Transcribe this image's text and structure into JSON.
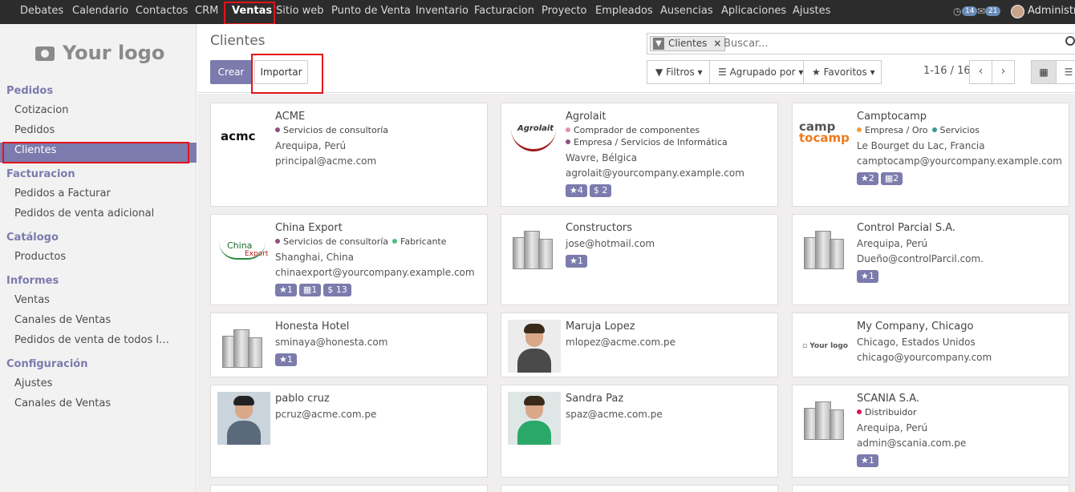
{
  "topnav": {
    "items": [
      "Debates",
      "Calendario",
      "Contactos",
      "CRM",
      "Ventas",
      "Sitio web",
      "Punto de Venta",
      "Inventario",
      "Facturacion",
      "Proyecto",
      "Empleados",
      "Ausencias",
      "Aplicaciones",
      "Ajustes"
    ],
    "active": "Ventas",
    "badge_activities": "14",
    "badge_messages": "21",
    "user": "Administrator"
  },
  "sidebar": {
    "logo": "Your logo",
    "sections": [
      {
        "title": "Pedidos",
        "items": [
          "Cotizacion",
          "Pedidos",
          "Clientes"
        ]
      },
      {
        "title": "Facturacion",
        "items": [
          "Pedidos a Facturar",
          "Pedidos de venta adicional"
        ]
      },
      {
        "title": "Catálogo",
        "items": [
          "Productos"
        ]
      },
      {
        "title": "Informes",
        "items": [
          "Ventas",
          "Canales de Ventas",
          "Pedidos de venta de todos los…"
        ]
      },
      {
        "title": "Configuración",
        "items": [
          "Ajustes",
          "Canales de Ventas"
        ]
      }
    ],
    "active_item": "Clientes"
  },
  "control": {
    "breadcrumb": "Clientes",
    "create_label": "Crear",
    "import_label": "Importar",
    "search_facet": "Clientes",
    "search_placeholder": "Buscar...",
    "filters_label": "Filtros",
    "groupby_label": "Agrupado por",
    "favorites_label": "Favoritos",
    "pager": "1-16 / 16"
  },
  "customers": [
    {
      "name": "ACME",
      "tags": [
        {
          "label": "Servicios de consultoría",
          "color": "#8e5280"
        }
      ],
      "lines": [
        "Arequipa, Perú",
        "principal@acme.com"
      ],
      "badges": [],
      "logo": "acme"
    },
    {
      "name": "Agrolait",
      "tags": [
        {
          "label": "Comprador de componentes",
          "color": "#e88eaa"
        },
        {
          "label": "Empresa / Servicios de Informática",
          "color": "#8e5280"
        }
      ],
      "lines": [
        "Wavre, Bélgica",
        "agrolait@yourcompany.example.com"
      ],
      "badges": [
        "★4",
        "$ 2"
      ],
      "logo": "agrolait"
    },
    {
      "name": "Camptocamp",
      "tags": [
        {
          "label": "Empresa / Oro",
          "color": "#f0a040"
        },
        {
          "label": "Servicios",
          "color": "#3a9a8a"
        }
      ],
      "lines": [
        "Le Bourget du Lac, Francia",
        "camptocamp@yourcompany.example.com"
      ],
      "badges": [
        "★2",
        "▦2"
      ],
      "logo": "camptocamp"
    },
    {
      "name": "China Export",
      "tags": [
        {
          "label": "Servicios de consultoría",
          "color": "#8e5280"
        },
        {
          "label": "Fabricante",
          "color": "#4cc07a"
        }
      ],
      "lines": [
        "Shanghai, China",
        "chinaexport@yourcompany.example.com"
      ],
      "badges": [
        "★1",
        "▦1",
        "$ 13"
      ],
      "logo": "chinaexport"
    },
    {
      "name": "Constructors",
      "tags": [],
      "lines": [
        "jose@hotmail.com"
      ],
      "badges": [
        "★1"
      ],
      "logo": "buildings"
    },
    {
      "name": "Control Parcial S.A.",
      "tags": [],
      "lines": [
        "Arequipa, Perú",
        "Dueño@controlParcil.com."
      ],
      "badges": [
        "★1"
      ],
      "logo": "buildings"
    },
    {
      "name": "Honesta Hotel",
      "tags": [],
      "lines": [
        "sminaya@honesta.com"
      ],
      "badges": [
        "★1"
      ],
      "logo": "buildings"
    },
    {
      "name": "Maruja Lopez",
      "tags": [],
      "lines": [
        "mlopez@acme.com.pe"
      ],
      "badges": [],
      "logo": "person-f1"
    },
    {
      "name": "My Company, Chicago",
      "tags": [],
      "lines": [
        "Chicago, Estados Unidos",
        "chicago@yourcompany.com"
      ],
      "badges": [],
      "logo": "yourlogo"
    },
    {
      "name": "pablo cruz",
      "tags": [],
      "lines": [
        "pcruz@acme.com.pe"
      ],
      "badges": [],
      "logo": "person-m"
    },
    {
      "name": "Sandra Paz",
      "tags": [],
      "lines": [
        "spaz@acme.com.pe"
      ],
      "badges": [],
      "logo": "person-f2"
    },
    {
      "name": "SCANIA S.A.",
      "tags": [
        {
          "label": "Distribuidor",
          "color": "#d6145f"
        }
      ],
      "lines": [
        "Arequipa, Perú",
        "admin@scania.com.pe"
      ],
      "badges": [
        "★1"
      ],
      "logo": "buildings"
    }
  ],
  "logo_texts": {
    "acme": "acmc",
    "agrolait": "Agrolait",
    "camptocamp_top": "camp",
    "camptocamp_bottom": "tocamp",
    "chinaexport_a": "China",
    "chinaexport_b": "Export",
    "yourlogo": "Your logo"
  },
  "colors": {
    "accent": "#7c7bad",
    "topbar": "#2c2c2c",
    "highlight": "#e3141a"
  }
}
